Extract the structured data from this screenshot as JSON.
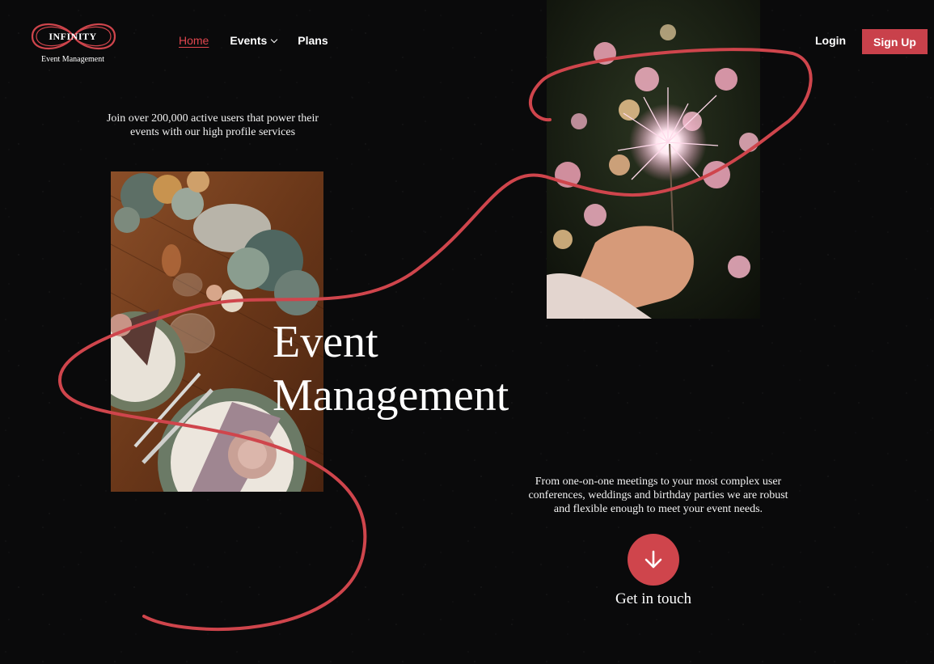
{
  "brand": {
    "name": "INFINITY",
    "tagline": "Event Management",
    "accent_color": "#cf454c"
  },
  "nav": {
    "items": [
      {
        "label": "Home",
        "active": true
      },
      {
        "label": "Events",
        "has_dropdown": true,
        "icon": "chevron-down-icon"
      },
      {
        "label": "Plans"
      }
    ]
  },
  "auth": {
    "login_label": "Login",
    "signup_label": "Sign Up"
  },
  "hero": {
    "intro": "Join over 200,000 active users that power their events with our high profile services",
    "headline_line1": "Event",
    "headline_line2": "Management",
    "description": "From one-on-one meetings to your most complex user conferences, weddings and birthday parties we are robust and flexible enough to meet your event needs.",
    "cta_label": "Get in touch",
    "cta_icon": "arrow-down-icon"
  },
  "images": {
    "table_photo": "dinner-table-setting",
    "sparkler_photo": "hand-holding-sparkler"
  }
}
